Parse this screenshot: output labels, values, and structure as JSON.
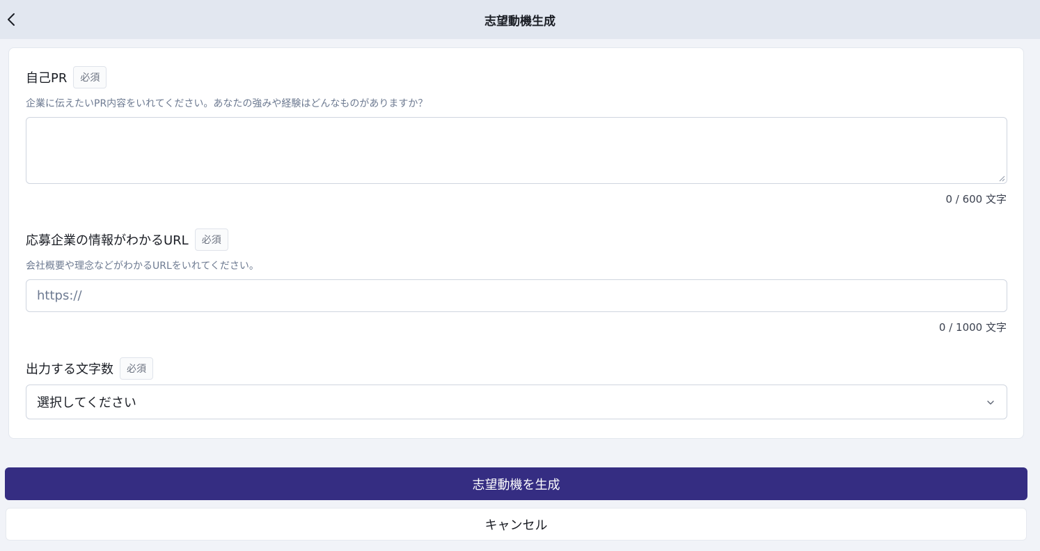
{
  "header": {
    "title": "志望動機生成",
    "back_icon": "chevron-left-icon"
  },
  "form": {
    "self_pr": {
      "label": "自己PR",
      "required": "必須",
      "hint": "企業に伝えたいPR内容をいれてください。あなたの強みや経験はどんなものがありますか？",
      "value": "",
      "counter": "0 / 600 文字"
    },
    "company_url": {
      "label": "応募企業の情報がわかるURL",
      "required": "必須",
      "hint": "会社概要や理念などがわかるURLをいれてください。",
      "placeholder": "https://",
      "counter": "0 / 1000 文字"
    },
    "char_count": {
      "label": "出力する文字数",
      "required": "必須",
      "selected": "選択してください",
      "icon": "chevron-down-icon"
    }
  },
  "actions": {
    "generate_label": "志望動機を生成",
    "cancel_label": "キャンセル"
  },
  "colors": {
    "header_bg": "#e2e7f0",
    "primary": "#352d82",
    "hint_text": "#6d7a91"
  }
}
